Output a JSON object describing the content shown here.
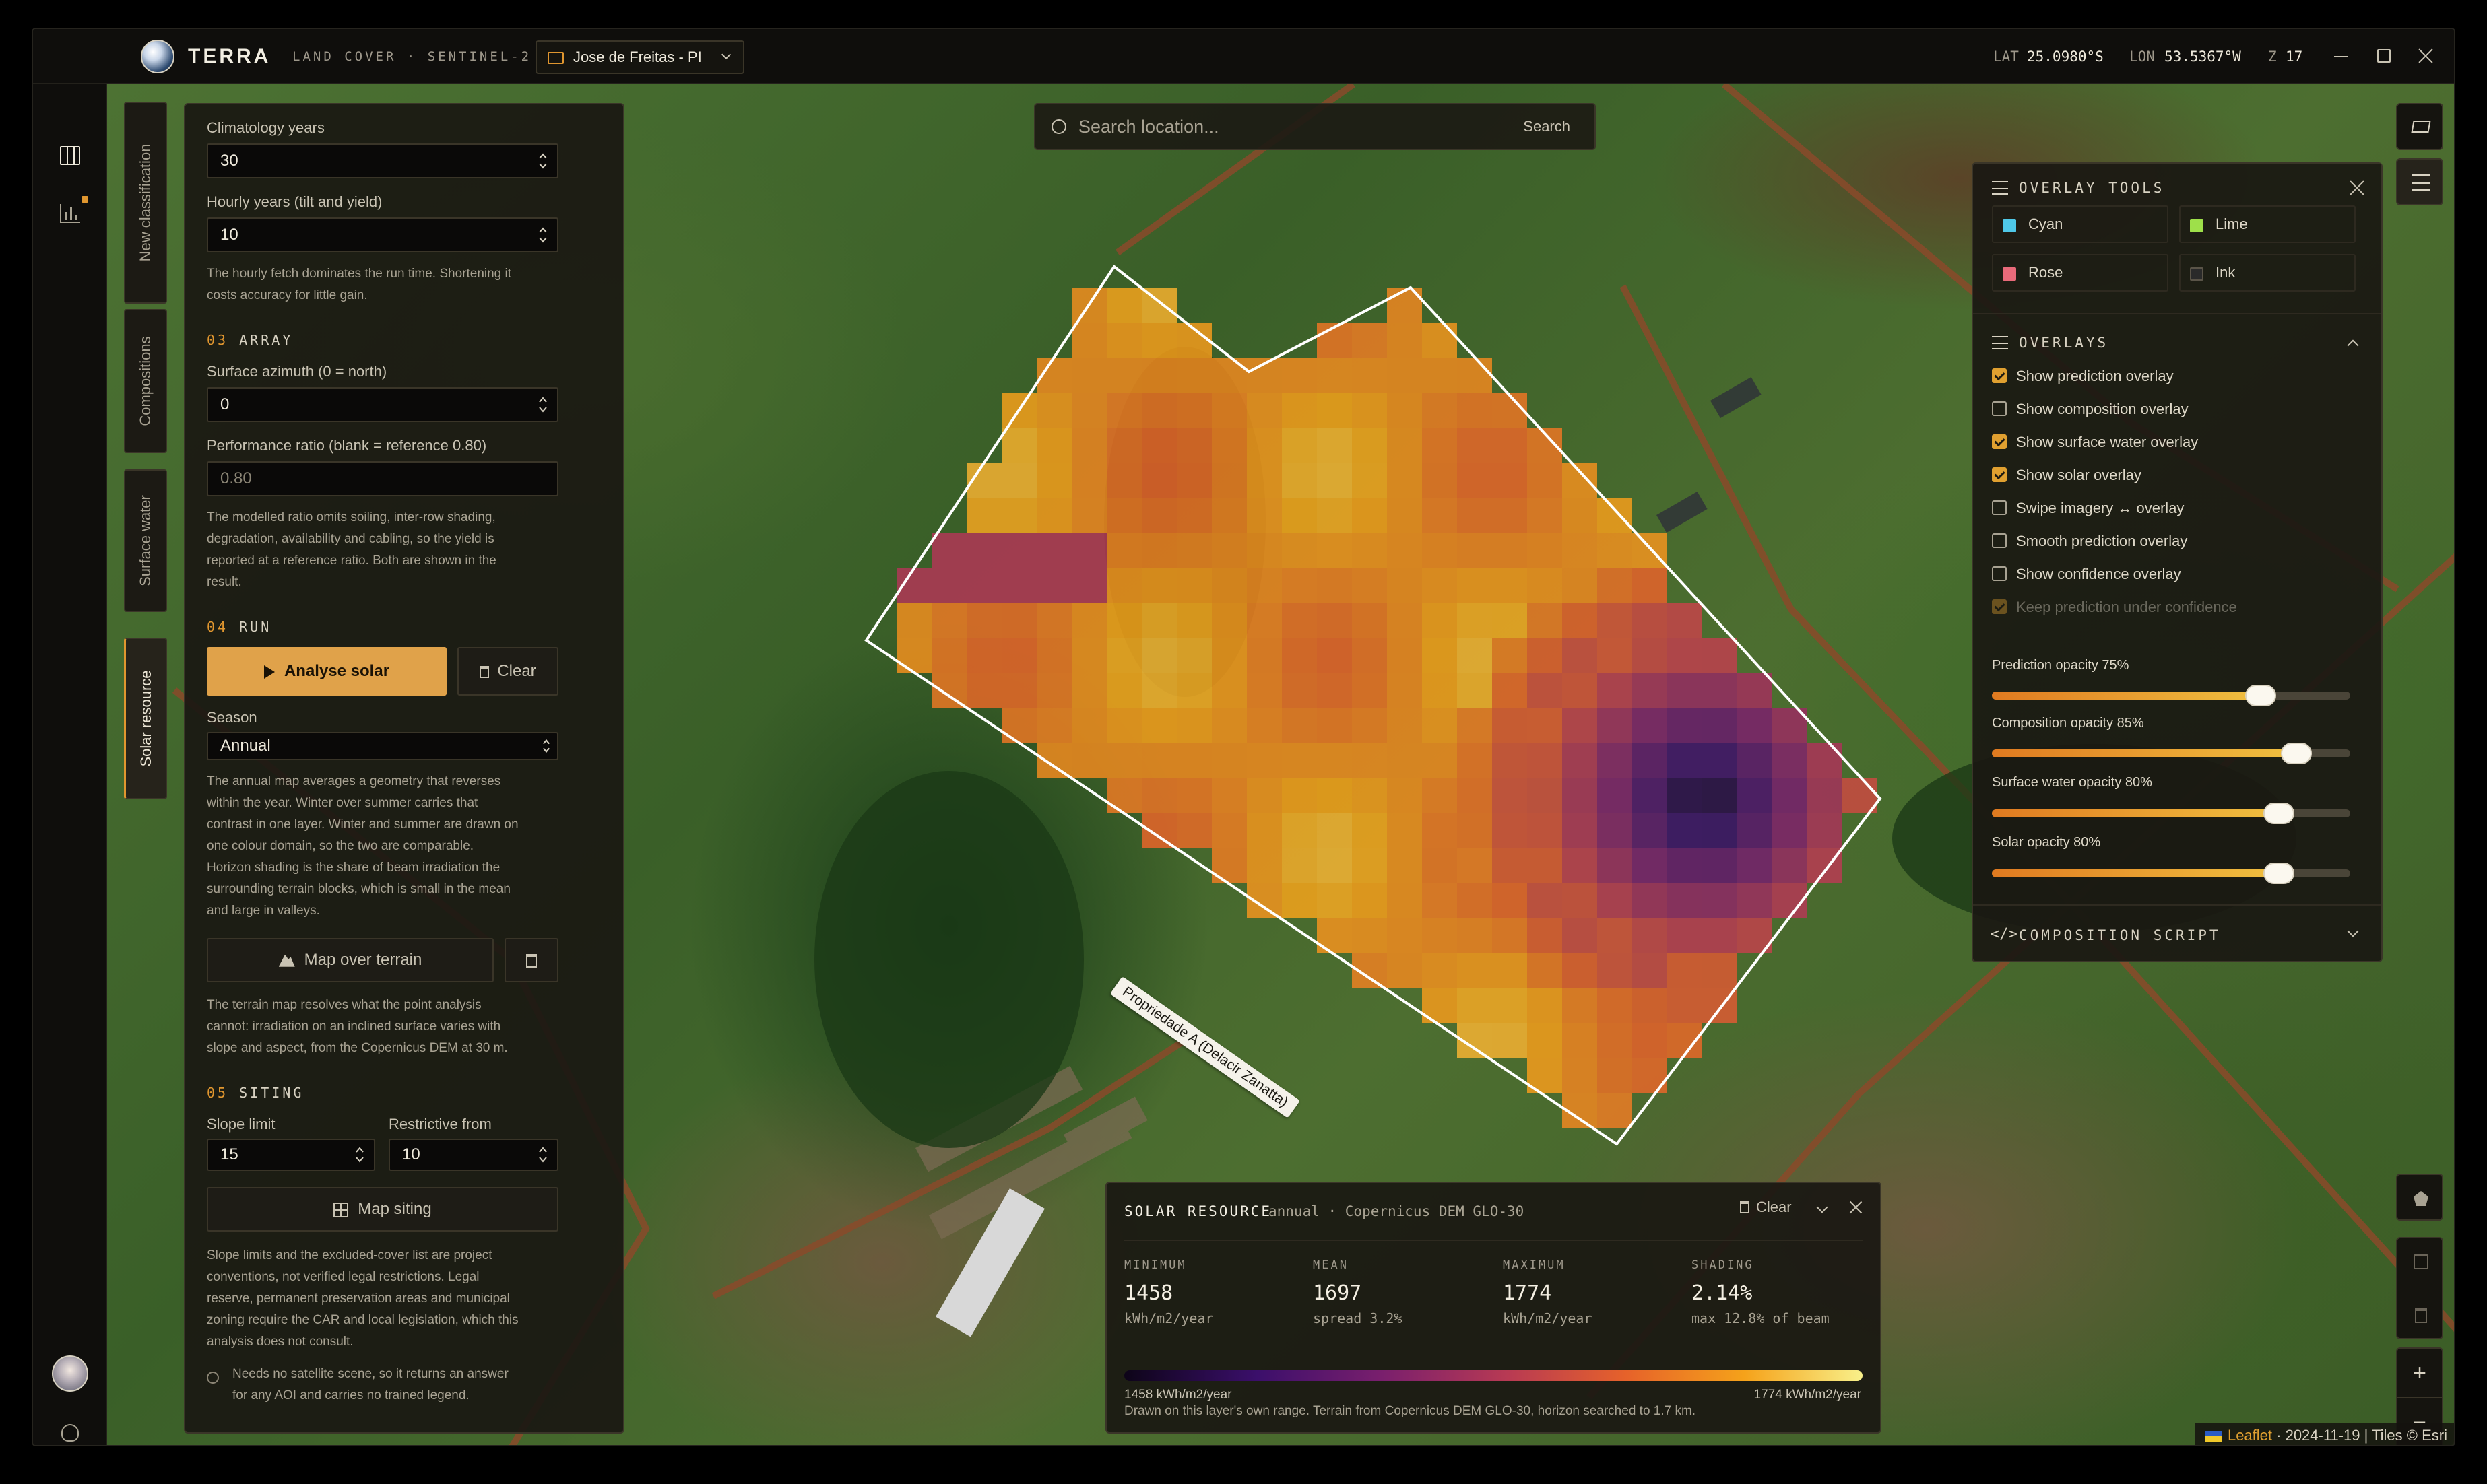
{
  "titlebar": {
    "app_name": "TERRA",
    "subtitle": "LAND COVER · SENTINEL-2",
    "project": "Jose de Freitas - PI",
    "lat_label": "LAT",
    "lat_value": "25.0980°S",
    "lon_label": "LON",
    "lon_value": "53.5367°W",
    "zoom_label": "Z",
    "zoom_value": "17"
  },
  "vertical_tabs": [
    {
      "label": "New classification",
      "active": false
    },
    {
      "label": "Compositions",
      "active": false
    },
    {
      "label": "Surface water",
      "active": false
    },
    {
      "label": "Solar resource",
      "active": true
    }
  ],
  "solar_panel": {
    "climatology_label": "Climatology years",
    "climatology_value": "30",
    "hourly_label": "Hourly years (tilt and yield)",
    "hourly_value": "10",
    "hourly_help": [
      "The hourly fetch dominates the run time. Shortening it",
      "costs accuracy for little gain."
    ],
    "array_num": "03",
    "array_title": "ARRAY",
    "azimuth_label": "Surface azimuth (0 = north)",
    "azimuth_value": "0",
    "perf_label": "Performance ratio (blank = reference 0.80)",
    "perf_placeholder": "0.80",
    "perf_help": [
      "The modelled ratio omits soiling, inter-row shading,",
      "degradation, availability and cabling, so the yield is",
      "reported at a reference ratio. Both are shown in the",
      "result."
    ],
    "run_num": "04",
    "run_title": "RUN",
    "analyse_label": "Analyse solar",
    "clear_label": "Clear",
    "season_label": "Season",
    "season_value": "Annual",
    "season_help": [
      "The annual map averages a geometry that reverses",
      "within the year. Winter over summer carries that",
      "contrast in one layer. Winter and summer are drawn on",
      "one colour domain, so the two are comparable.",
      "Horizon shading is the share of beam irradiation the",
      "surrounding terrain blocks, which is small in the mean",
      "and large in valleys."
    ],
    "terrain_label": "Map over terrain",
    "terrain_help": [
      "The terrain map resolves what the point analysis",
      "cannot: irradiation on an inclined surface varies with",
      "slope and aspect, from the Copernicus DEM at 30 m."
    ],
    "siting_num": "05",
    "siting_title": "SITING",
    "slope_label": "Slope limit",
    "slope_value": "15",
    "restrictive_label": "Restrictive from",
    "restrictive_value": "10",
    "siting_label": "Map siting",
    "siting_help": [
      "Slope limits and the excluded-cover list are project",
      "conventions, not verified legal restrictions. Legal",
      "reserve, permanent preservation areas and municipal",
      "zoning require the CAR and local legislation, which this",
      "analysis does not consult."
    ],
    "note": [
      "Needs no satellite scene, so it returns an answer",
      "for any AOI and carries no trained legend."
    ]
  },
  "search": {
    "placeholder": "Search location...",
    "button": "Search"
  },
  "aoi_label": "Propriedade A (Delacir Zanatta)",
  "overlay_tools": {
    "title": "OVERLAY TOOLS",
    "colors": [
      {
        "name": "Cyan",
        "hex": "#4fc8e8"
      },
      {
        "name": "Lime",
        "hex": "#9ee04a"
      },
      {
        "name": "Rose",
        "hex": "#e86a7a"
      },
      {
        "name": "Ink",
        "hex": "#2a2a2a"
      }
    ],
    "overlays_title": "OVERLAYS",
    "overlays": [
      {
        "label": "Show prediction overlay",
        "checked": true
      },
      {
        "label": "Show composition overlay",
        "checked": false
      },
      {
        "label": "Show surface water overlay",
        "checked": true
      },
      {
        "label": "Show solar overlay",
        "checked": true
      },
      {
        "label": "Swipe imagery ↔ overlay",
        "checked": false
      },
      {
        "label": "Smooth prediction overlay",
        "checked": false
      },
      {
        "label": "Show confidence overlay",
        "checked": false
      },
      {
        "label": "Keep prediction under confidence",
        "checked": true,
        "disabled": true
      }
    ],
    "sliders": [
      {
        "label": "Prediction opacity 75%",
        "value": 0.75
      },
      {
        "label": "Composition opacity 85%",
        "value": 0.85
      },
      {
        "label": "Surface water opacity 80%",
        "value": 0.8
      },
      {
        "label": "Solar opacity 80%",
        "value": 0.8
      }
    ],
    "composition_script": "COMPOSITION SCRIPT"
  },
  "solar_result": {
    "title": "SOLAR RESOURCE",
    "subtitle": "annual · Copernicus DEM GLO-30",
    "clear": "Clear",
    "stats": [
      {
        "key": "MINIMUM",
        "value": "1458",
        "sub": "kWh/m2/year"
      },
      {
        "key": "MEAN",
        "value": "1697",
        "sub": "spread 3.2%"
      },
      {
        "key": "MAXIMUM",
        "value": "1774",
        "sub": "kWh/m2/year"
      },
      {
        "key": "SHADING",
        "value": "2.14%",
        "sub": "max 12.8% of beam"
      }
    ],
    "legend_min": "1458 kWh/m2/year",
    "legend_max": "1774 kWh/m2/year",
    "footer": "Drawn on this layer's own range. Terrain from Copernicus DEM GLO-30, horizon searched to 1.7 km."
  },
  "attribution": {
    "leaflet": "Leaflet",
    "date": "· 2024-11-19 |",
    "tiles": "Tiles © Esri"
  }
}
